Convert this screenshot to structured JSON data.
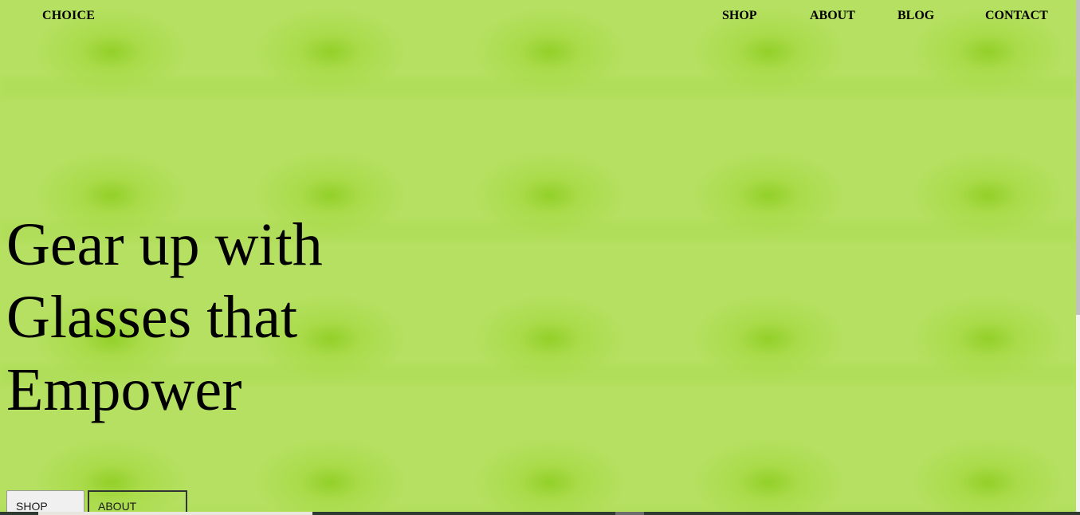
{
  "brand": {
    "logo": "CHOICE"
  },
  "nav": {
    "items": [
      {
        "label": "SHOP"
      },
      {
        "label": "ABOUT"
      },
      {
        "label": "BLOG"
      },
      {
        "label": "CONTACT"
      }
    ]
  },
  "hero": {
    "headline_line1": "Gear up with",
    "headline_line2": "Glasses that",
    "headline_line3": "Empower",
    "primary_button": "SHOP NOW",
    "secondary_button": "ABOUT CHOICE"
  },
  "colors": {
    "background": "#b5e061",
    "pattern_spot": "#8ccd1e",
    "text": "#000000"
  }
}
